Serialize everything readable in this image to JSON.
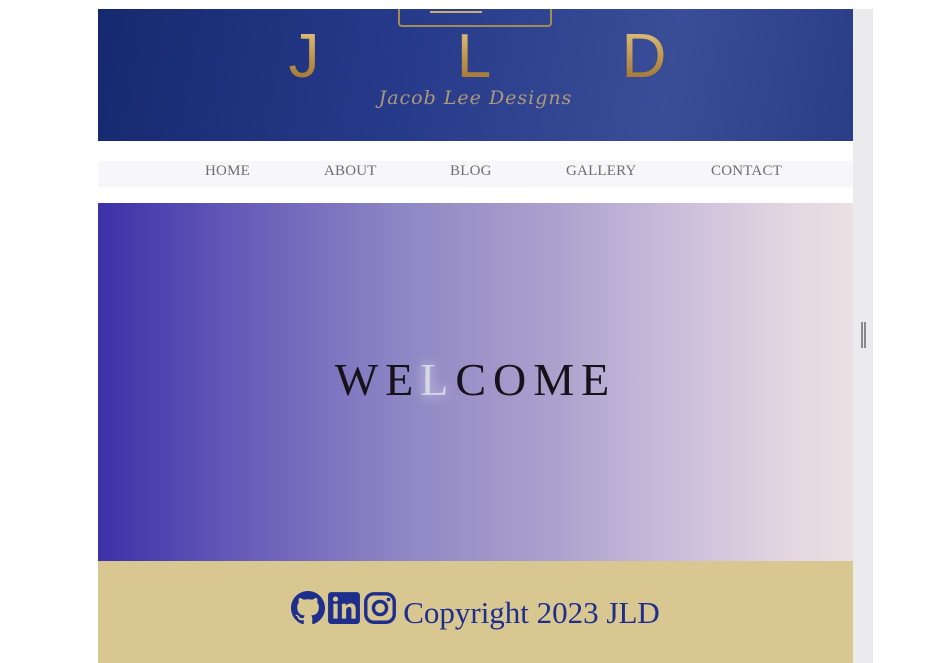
{
  "brand": {
    "letters": [
      "J",
      "L",
      "D"
    ],
    "script_text": "Jacob Lee Designs"
  },
  "nav": {
    "items": [
      {
        "label": "HOME"
      },
      {
        "label": "ABOUT"
      },
      {
        "label": "BLOG"
      },
      {
        "label": "GALLERY"
      },
      {
        "label": "CONTACT"
      }
    ]
  },
  "hero": {
    "welcome_parts": [
      "WE",
      "L",
      "COME"
    ]
  },
  "footer": {
    "icons": [
      "github-icon",
      "linkedin-icon",
      "instagram-icon"
    ],
    "copyright": "Copyright 2023 JLD"
  },
  "colors": {
    "banner": "#1f3180",
    "gold": "#cda862",
    "footer_bg": "#d9c792",
    "footer_text": "#1e2e8c",
    "hero_start": "#3c31a8",
    "hero_end": "#ebe0e3"
  }
}
